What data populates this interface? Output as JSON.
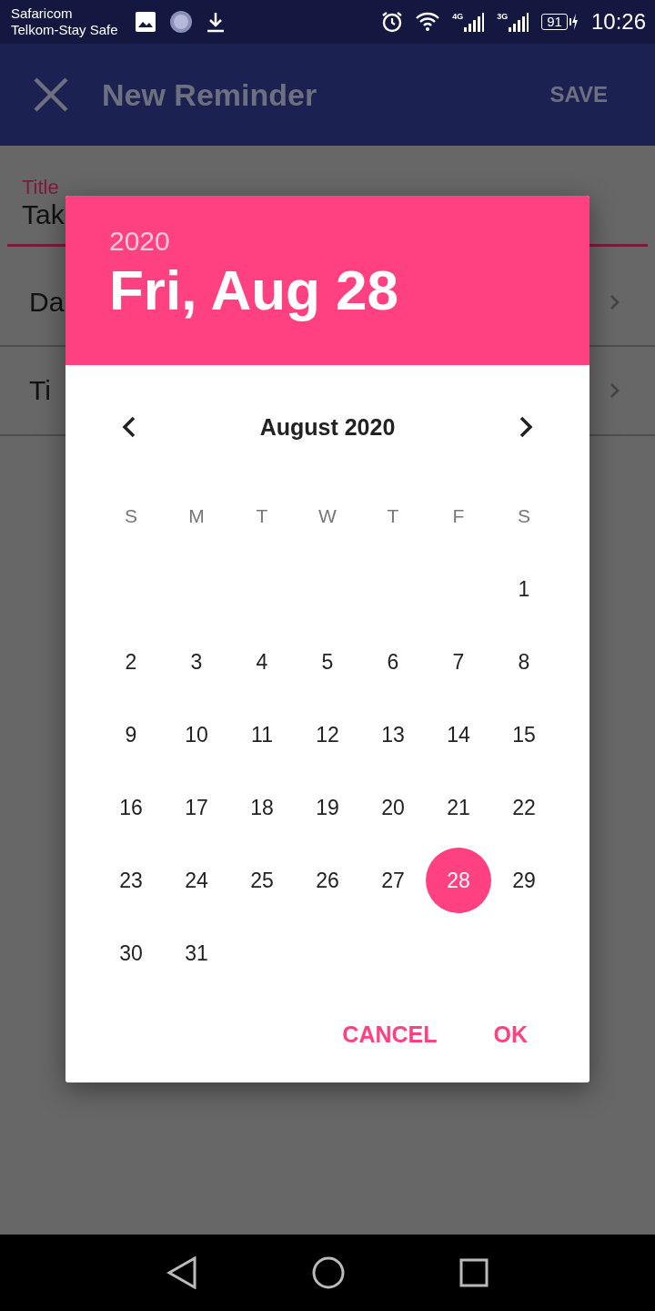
{
  "status_bar": {
    "carriers": [
      "Safaricom",
      "Telkom-Stay Safe"
    ],
    "networks": [
      "4G",
      "3G"
    ],
    "battery": "91",
    "time": "10:26"
  },
  "app_bar": {
    "title": "New Reminder",
    "action": "SAVE"
  },
  "form": {
    "title_field": {
      "label": "Title",
      "value": "Tak"
    },
    "rows": [
      {
        "label": "Da"
      },
      {
        "label": "Ti"
      }
    ]
  },
  "date_picker": {
    "year": "2020",
    "date": "Fri, Aug 28",
    "month": "August 2020",
    "weekdays": [
      "S",
      "M",
      "T",
      "W",
      "T",
      "F",
      "S"
    ],
    "weeks": [
      [
        {
          "label": "1",
          "selected": false
        }
      ],
      [
        {
          "label": "2",
          "selected": false
        },
        {
          "label": "3",
          "selected": false
        },
        {
          "label": "4",
          "selected": false
        },
        {
          "label": "5",
          "selected": false
        },
        {
          "label": "6",
          "selected": false
        },
        {
          "label": "7",
          "selected": false
        },
        {
          "label": "8",
          "selected": false
        }
      ],
      [
        {
          "label": "9",
          "selected": false
        },
        {
          "label": "10",
          "selected": false
        },
        {
          "label": "11",
          "selected": false
        },
        {
          "label": "12",
          "selected": false
        },
        {
          "label": "13",
          "selected": false
        },
        {
          "label": "14",
          "selected": false
        },
        {
          "label": "15",
          "selected": false
        }
      ],
      [
        {
          "label": "16",
          "selected": false
        },
        {
          "label": "17",
          "selected": false
        },
        {
          "label": "18",
          "selected": false
        },
        {
          "label": "19",
          "selected": false
        },
        {
          "label": "20",
          "selected": false
        },
        {
          "label": "21",
          "selected": false
        },
        {
          "label": "22",
          "selected": false
        }
      ],
      [
        {
          "label": "23",
          "selected": false
        },
        {
          "label": "24",
          "selected": false
        },
        {
          "label": "25",
          "selected": false
        },
        {
          "label": "26",
          "selected": false
        },
        {
          "label": "27",
          "selected": false
        },
        {
          "label": "28",
          "selected": true
        },
        {
          "label": "29",
          "selected": false
        }
      ],
      [
        {
          "label": "30",
          "selected": false
        },
        {
          "label": "31",
          "selected": false
        }
      ]
    ],
    "buttons": [
      "CANCEL",
      "OK"
    ]
  }
}
